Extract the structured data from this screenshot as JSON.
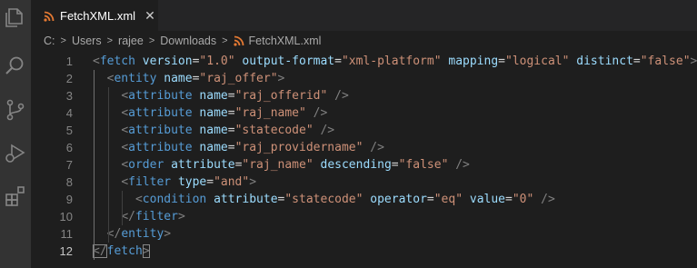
{
  "tab": {
    "filename": "FetchXML.xml",
    "close_glyph": "✕"
  },
  "breadcrumb": {
    "items": [
      "C:",
      "Users",
      "rajee",
      "Downloads"
    ],
    "file": "FetchXML.xml",
    "separator": ">"
  },
  "colors": {
    "tag": "#569cd6",
    "attribute": "#9cdcfe",
    "string": "#ce9178",
    "bracket": "#808080",
    "file_icon": "#e37933"
  },
  "activity_icons": [
    "explorer-icon",
    "search-icon",
    "source-control-icon",
    "run-debug-icon",
    "extensions-icon"
  ],
  "editor": {
    "active_line": 12,
    "lines": [
      {
        "n": "1",
        "tag": "fetch",
        "close": false,
        "attrs": [
          [
            "version",
            "\"1.0\""
          ],
          [
            "output-format",
            "\"xml-platform\""
          ],
          [
            "mapping",
            "\"logical\""
          ],
          [
            "distinct",
            "\"false\""
          ]
        ],
        "end": ">"
      },
      {
        "n": "2",
        "tag": "entity",
        "close": false,
        "attrs": [
          [
            "name",
            "\"raj_offer\""
          ]
        ],
        "end": ">"
      },
      {
        "n": "3",
        "tag": "attribute",
        "close": false,
        "attrs": [
          [
            "name",
            "\"raj_offerid\""
          ]
        ],
        "end": " />"
      },
      {
        "n": "4",
        "tag": "attribute",
        "close": false,
        "attrs": [
          [
            "name",
            "\"raj_name\""
          ]
        ],
        "end": " />"
      },
      {
        "n": "5",
        "tag": "attribute",
        "close": false,
        "attrs": [
          [
            "name",
            "\"statecode\""
          ]
        ],
        "end": " />"
      },
      {
        "n": "6",
        "tag": "attribute",
        "close": false,
        "attrs": [
          [
            "name",
            "\"raj_providername\""
          ]
        ],
        "end": " />"
      },
      {
        "n": "7",
        "tag": "order",
        "close": false,
        "attrs": [
          [
            "attribute",
            "\"raj_name\""
          ],
          [
            "descending",
            "\"false\""
          ]
        ],
        "end": " />"
      },
      {
        "n": "8",
        "tag": "filter",
        "close": false,
        "attrs": [
          [
            "type",
            "\"and\""
          ]
        ],
        "end": ">"
      },
      {
        "n": "9",
        "tag": "condition",
        "close": false,
        "attrs": [
          [
            "attribute",
            "\"statecode\""
          ],
          [
            "operator",
            "\"eq\""
          ],
          [
            "value",
            "\"0\""
          ]
        ],
        "end": " />"
      },
      {
        "n": "10",
        "tag": "filter",
        "close": true,
        "attrs": [],
        "end": ">"
      },
      {
        "n": "11",
        "tag": "entity",
        "close": true,
        "attrs": [],
        "end": ">"
      },
      {
        "n": "12",
        "tag": "fetch",
        "close": true,
        "attrs": [],
        "end": ">"
      }
    ]
  }
}
